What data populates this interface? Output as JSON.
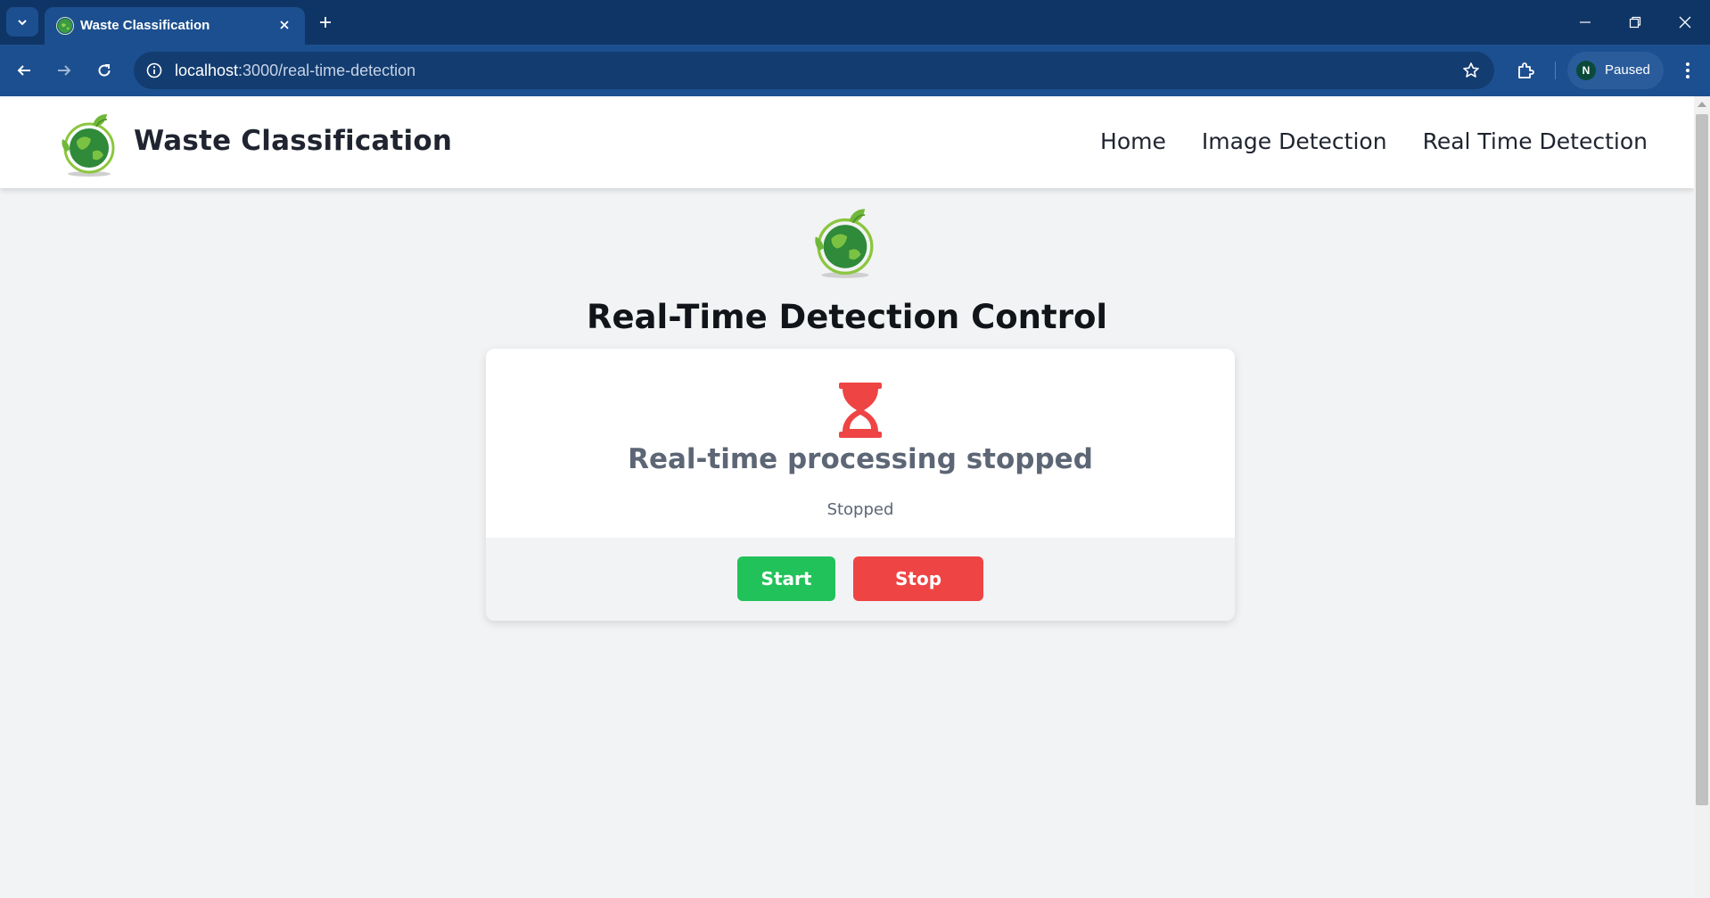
{
  "browser": {
    "tab_title": "Waste Classification",
    "url_host": "localhost",
    "url_path": ":3000/real-time-detection",
    "profile_initial": "N",
    "profile_label": "Paused"
  },
  "header": {
    "brand": "Waste Classification",
    "nav": [
      "Home",
      "Image Detection",
      "Real Time Detection"
    ]
  },
  "main": {
    "title": "Real-Time Detection Control",
    "status_title": "Real-time processing stopped",
    "status_text": "Stopped",
    "start_label": "Start",
    "stop_label": "Stop"
  },
  "colors": {
    "browser_dark": "#0f3566",
    "browser_bar": "#1c4f8f",
    "start_green": "#22c25a",
    "stop_red": "#ef4444",
    "hourglass_red": "#ef4444",
    "page_bg": "#f2f3f5"
  },
  "icons": [
    "globe-leaf-logo",
    "hourglass-icon",
    "star-icon",
    "puzzle-icon",
    "info-icon"
  ]
}
